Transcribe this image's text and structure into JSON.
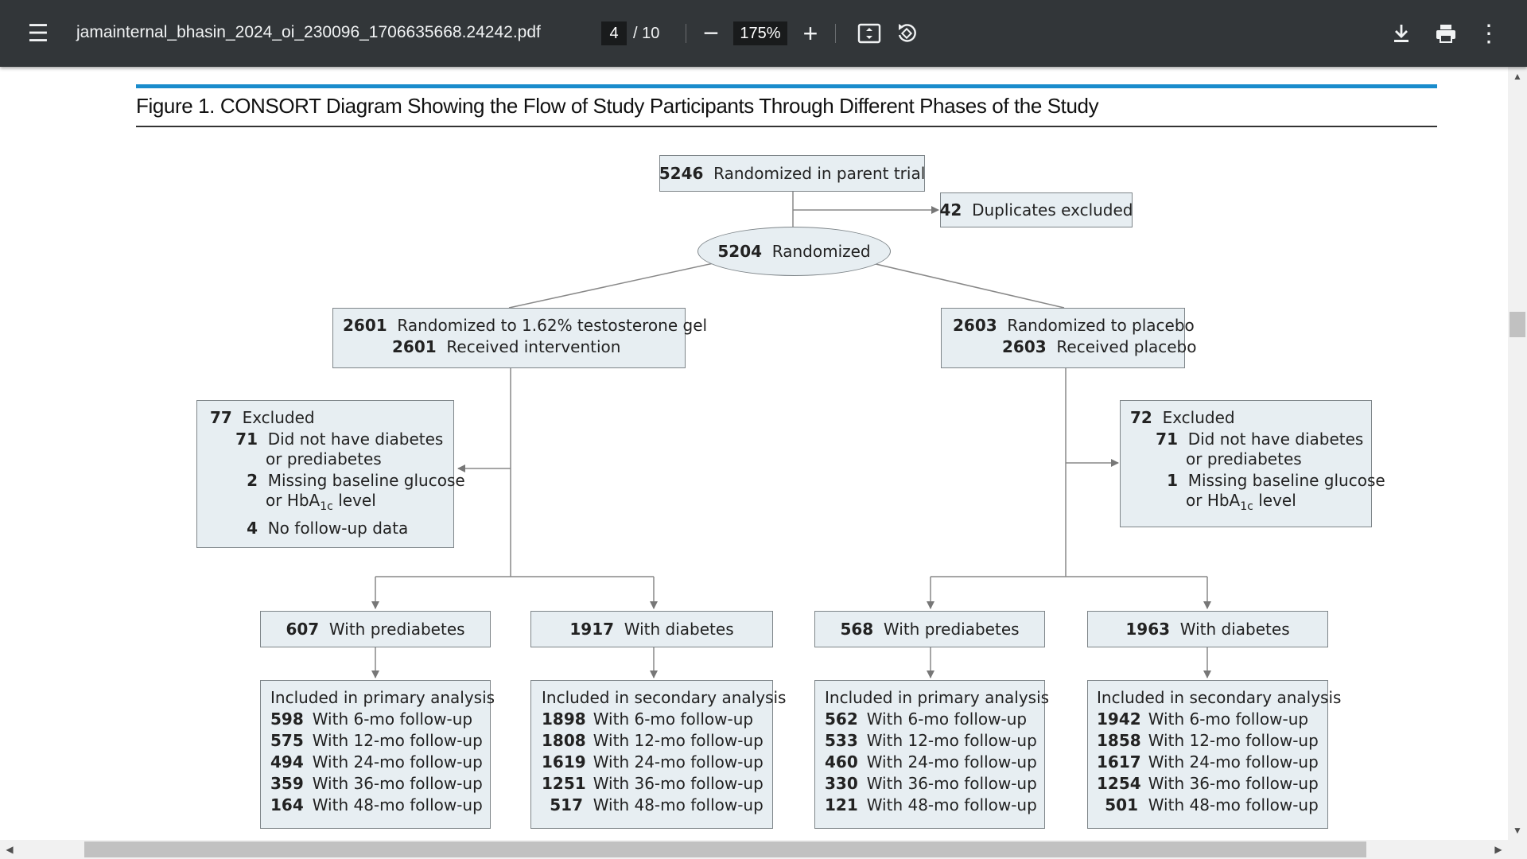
{
  "toolbar": {
    "title": "jamainternal_bhasin_2024_oi_230096_1706635668.24242.pdf",
    "page_current": "4",
    "page_total": "/ 10",
    "zoom": "175%",
    "icons": [
      "menu-icon",
      "minus-icon",
      "plus-icon",
      "fit-page-icon",
      "rotate-icon",
      "download-icon",
      "print-icon",
      "more-vert-icon"
    ]
  },
  "figure": {
    "title": "Figure 1. CONSORT Diagram Showing the Flow of Study Participants Through Different Phases of the Study",
    "parent": {
      "n": "5246",
      "label": "Randomized in parent trial"
    },
    "duplicates": {
      "n": "42",
      "label": "Duplicates excluded"
    },
    "randomized": {
      "n": "5204",
      "label": "Randomized"
    },
    "arm_t": {
      "n1": "2601",
      "label1": "Randomized to 1.62% testosterone gel",
      "n2": "2601",
      "label2": "Received intervention"
    },
    "arm_p": {
      "n1": "2603",
      "label1": "Randomized to placebo",
      "n2": "2603",
      "label2": "Received placebo"
    },
    "excl_t": {
      "n": "77",
      "label": "Excluded",
      "r1n": "71",
      "r1a": "Did not have diabetes",
      "r1b": "or prediabetes",
      "r2n": "2",
      "r2a": "Missing baseline glucose",
      "r2b": "or HbA",
      "r2sub": "1c",
      "r2c": "level",
      "r3n": "4",
      "r3a": "No follow-up data"
    },
    "excl_p": {
      "n": "72",
      "label": "Excluded",
      "r1n": "71",
      "r1a": "Did not have diabetes",
      "r1b": "or prediabetes",
      "r2n": "1",
      "r2a": "Missing baseline glucose",
      "r2b": "or HbA",
      "r2sub": "1c",
      "r2c": "level"
    },
    "groups": [
      {
        "n": "607",
        "label": "With prediabetes"
      },
      {
        "n": "1917",
        "label": "With diabetes"
      },
      {
        "n": "568",
        "label": "With prediabetes"
      },
      {
        "n": "1963",
        "label": "With diabetes"
      }
    ],
    "analyses": [
      {
        "title": "Included in primary analysis",
        "rows": [
          {
            "n": "598",
            "label": "With 6-mo follow-up"
          },
          {
            "n": "575",
            "label": "With 12-mo follow-up"
          },
          {
            "n": "494",
            "label": "With 24-mo follow-up"
          },
          {
            "n": "359",
            "label": "With 36-mo follow-up"
          },
          {
            "n": "164",
            "label": "With 48-mo follow-up"
          }
        ]
      },
      {
        "title": "Included in secondary analysis",
        "rows": [
          {
            "n": "1898",
            "label": "With 6-mo follow-up"
          },
          {
            "n": "1808",
            "label": "With 12-mo follow-up"
          },
          {
            "n": "1619",
            "label": "With 24-mo follow-up"
          },
          {
            "n": "1251",
            "label": "With 36-mo follow-up"
          },
          {
            "n": "517",
            "label": "With 48-mo follow-up"
          }
        ]
      },
      {
        "title": "Included in primary analysis",
        "rows": [
          {
            "n": "562",
            "label": "With 6-mo follow-up"
          },
          {
            "n": "533",
            "label": "With 12-mo follow-up"
          },
          {
            "n": "460",
            "label": "With 24-mo follow-up"
          },
          {
            "n": "330",
            "label": "With 36-mo follow-up"
          },
          {
            "n": "121",
            "label": "With 48-mo follow-up"
          }
        ]
      },
      {
        "title": "Included in secondary analysis",
        "rows": [
          {
            "n": "1942",
            "label": "With 6-mo follow-up"
          },
          {
            "n": "1858",
            "label": "With 12-mo follow-up"
          },
          {
            "n": "1617",
            "label": "With 24-mo follow-up"
          },
          {
            "n": "1254",
            "label": "With 36-mo follow-up"
          },
          {
            "n": "501",
            "label": "With 48-mo follow-up"
          }
        ]
      }
    ]
  }
}
